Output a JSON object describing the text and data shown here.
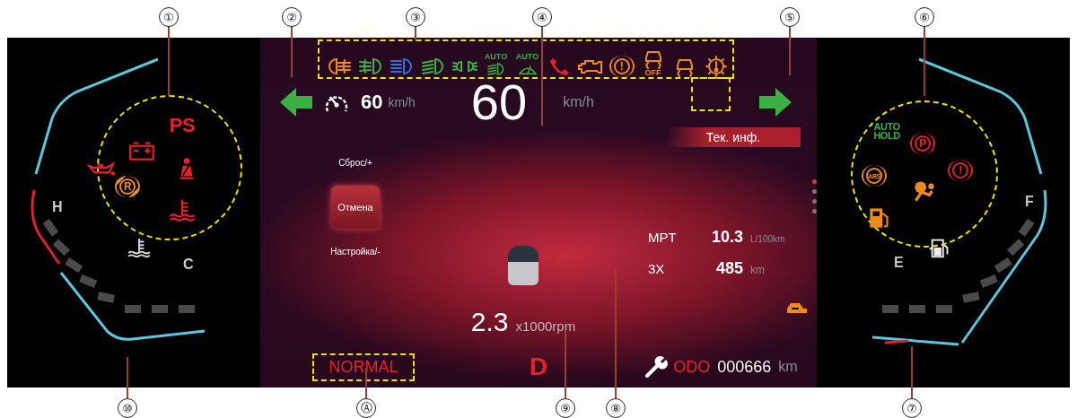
{
  "callouts_top": [
    "①",
    "②",
    "③",
    "④",
    "⑤",
    "⑥"
  ],
  "callouts_bottom": [
    "⑩",
    "Ⓐ",
    "⑨",
    "⑧",
    "⑦"
  ],
  "temperature_gauge": {
    "hot_label": "H",
    "cold_label": "C"
  },
  "left_warnings": [
    {
      "kind": "text",
      "label": "PS",
      "color": "#e8202a"
    },
    {
      "kind": "battery",
      "color": "#e8202a"
    },
    {
      "kind": "oil",
      "color": "#e8202a"
    },
    {
      "kind": "seatbelt",
      "color": "#e8202a"
    },
    {
      "kind": "ring",
      "label": "R",
      "slash": true,
      "color": "#f08a1c"
    },
    {
      "kind": "coolant",
      "color": "#e8202a"
    }
  ],
  "indicators": [
    {
      "kind": "rear-fog",
      "color": "#f08a1c"
    },
    {
      "kind": "front-fog",
      "color": "#3cb043"
    },
    {
      "kind": "high-beam",
      "color": "#2f6fe0"
    },
    {
      "kind": "low-beam",
      "color": "#3cb043"
    },
    {
      "kind": "position-lights",
      "color": "#3cb043"
    },
    {
      "kind": "low-beam",
      "label": "AUTO",
      "color": "#3cb043"
    },
    {
      "kind": "wiper",
      "label": "AUTO",
      "color": "#3cb043"
    },
    {
      "kind": "phone",
      "color": "#e8202a"
    },
    {
      "kind": "engine",
      "color": "#f08a1c"
    },
    {
      "kind": "ring",
      "label": "!",
      "color": "#f08a1c"
    },
    {
      "kind": "stability",
      "sublabel": "OFF",
      "color": "#f08a1c"
    },
    {
      "kind": "stability",
      "color": "#f08a1c"
    },
    {
      "kind": "overheat",
      "color": "#f08a1c"
    }
  ],
  "turn_signals": {
    "left": {
      "on": true
    },
    "right": {
      "on": true
    }
  },
  "speed_limit": {
    "value": "60",
    "unit": "km/h"
  },
  "speed": {
    "value": "60",
    "unit": "km/h"
  },
  "menu": [
    {
      "label": "Сброс/+",
      "selected": false
    },
    {
      "label": "Отмена",
      "selected": true
    },
    {
      "label": "Настройка/-",
      "selected": false
    }
  ],
  "info": {
    "tab": "Тек. инф.",
    "rows": [
      {
        "label": "MPT",
        "value": "10.3",
        "unit": "L/100km"
      },
      {
        "label": "3X",
        "value": "485",
        "unit": "km"
      }
    ],
    "pages": [
      {
        "selected": true
      },
      {
        "selected": false
      },
      {
        "selected": false
      },
      {
        "selected": false
      }
    ]
  },
  "rpm": {
    "value": "2.3",
    "unit": "x1000rpm"
  },
  "drive_mode": "NORMAL",
  "gear": "D",
  "odometer": {
    "label": "ODO",
    "value": "000666",
    "unit": "km"
  },
  "fuel_gauge": {
    "full_label": "F",
    "empty_label": "E"
  },
  "right_warnings": [
    {
      "kind": "text",
      "label": "AUTO HOLD",
      "color": "#3cb043"
    },
    {
      "kind": "ring",
      "label": "P",
      "color": "#e8202a"
    },
    {
      "kind": "ring",
      "label": "ABS",
      "color": "#f08a1c"
    },
    {
      "kind": "ring",
      "label": "!",
      "color": "#e8202a"
    },
    {
      "kind": "airbag",
      "color": "#f08a1c"
    },
    {
      "kind": "fuel",
      "color": "#f08a1c"
    }
  ]
}
